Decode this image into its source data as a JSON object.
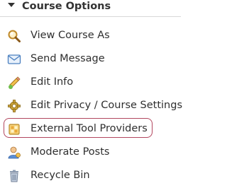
{
  "panel": {
    "title": "Course Options",
    "items": [
      {
        "label": "View Course As",
        "icon": "magnifier-icon"
      },
      {
        "label": "Send Message",
        "icon": "envelope-icon"
      },
      {
        "label": "Edit Info",
        "icon": "pencil-icon"
      },
      {
        "label": "Edit Privacy / Course Settings",
        "icon": "gear-icon"
      },
      {
        "label": "External Tool Providers",
        "icon": "tool-box-icon",
        "highlighted": true
      },
      {
        "label": "Moderate Posts",
        "icon": "user-moderator-icon"
      },
      {
        "label": "Recycle Bin",
        "icon": "recycle-bin-icon"
      }
    ]
  },
  "colors": {
    "highlight_border": "#b2465e",
    "text": "#2f2f2f",
    "divider": "#d7d7d7"
  }
}
